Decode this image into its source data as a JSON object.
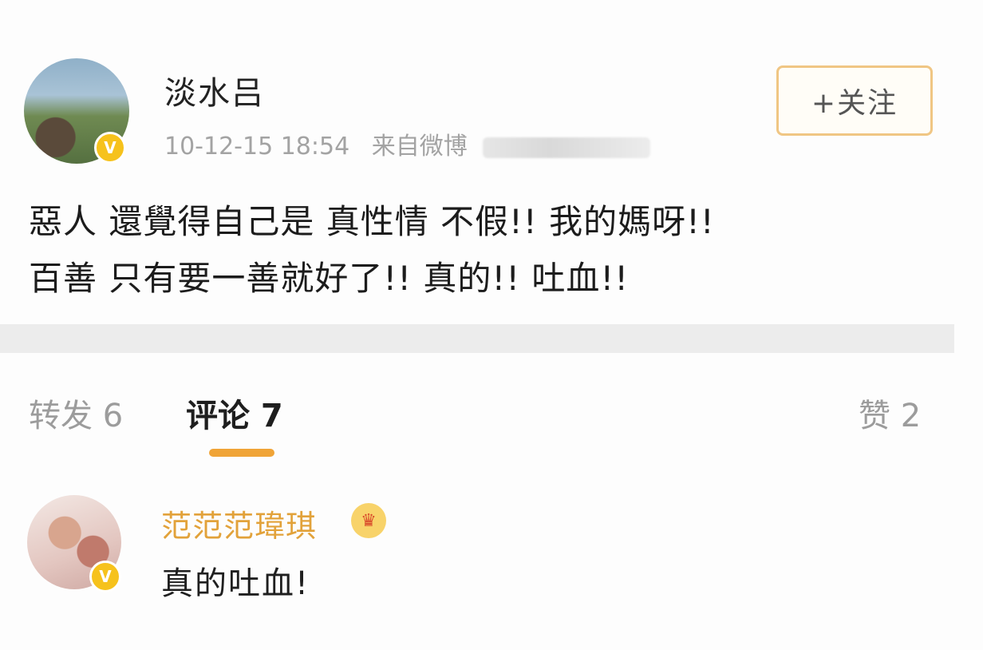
{
  "post": {
    "author": "淡水吕",
    "timestamp": "10-12-15 18:54",
    "source_prefix": "来自微博",
    "follow_label": "+关注",
    "verified_badge": "V",
    "body_lines": [
      "惡人 還覺得自己是 真性情   不假!! 我的媽呀!!",
      "百善  只有要一善就好了!! 真的!! 吐血!!"
    ]
  },
  "tabs": {
    "repost": "转发 6",
    "comment": "评论 7",
    "like": "赞 2"
  },
  "comment": {
    "name": "范范范瑋琪",
    "badge": "♛",
    "verified_badge": "V",
    "text": "真的吐血!"
  },
  "colors": {
    "accent": "#f0a437",
    "follow_border": "#f0c684",
    "commenter_name": "#e2a23a",
    "verified": "#f6c21c"
  },
  "icons": {
    "verified": "verified-badge-icon",
    "crown": "crown-badge-icon"
  }
}
